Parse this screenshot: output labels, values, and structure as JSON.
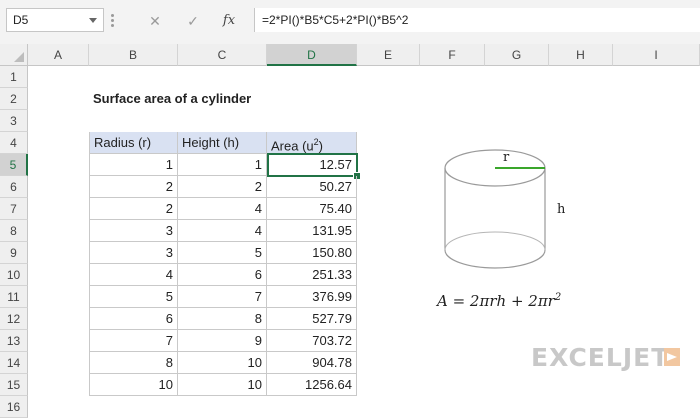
{
  "name_box": "D5",
  "formula_bar": {
    "cancel_glyph": "✕",
    "enter_glyph": "✓",
    "fx_label": "fx",
    "formula": "=2*PI()*B5*C5+2*PI()*B5^2"
  },
  "columns": [
    "A",
    "B",
    "C",
    "D",
    "E",
    "F",
    "G",
    "H",
    "I"
  ],
  "rows": [
    "1",
    "2",
    "3",
    "4",
    "5",
    "6",
    "7",
    "8",
    "9",
    "10",
    "11",
    "12",
    "13",
    "14",
    "15",
    "16"
  ],
  "sheet": {
    "title": "Surface area of a cylinder",
    "headers": {
      "radius": "Radius (r)",
      "height": "Height (h)",
      "area": "Area (u",
      "area_sup": "2",
      "area_close": ")"
    },
    "data_rows": [
      {
        "r": "1",
        "h": "1",
        "area": "12.57"
      },
      {
        "r": "2",
        "h": "2",
        "area": "50.27"
      },
      {
        "r": "2",
        "h": "4",
        "area": "75.40"
      },
      {
        "r": "3",
        "h": "4",
        "area": "131.95"
      },
      {
        "r": "3",
        "h": "5",
        "area": "150.80"
      },
      {
        "r": "4",
        "h": "6",
        "area": "251.33"
      },
      {
        "r": "5",
        "h": "7",
        "area": "376.99"
      },
      {
        "r": "6",
        "h": "8",
        "area": "527.79"
      },
      {
        "r": "7",
        "h": "9",
        "area": "703.72"
      },
      {
        "r": "8",
        "h": "10",
        "area": "904.78"
      },
      {
        "r": "10",
        "h": "10",
        "area": "1256.64"
      }
    ]
  },
  "diagram": {
    "radius_label": "r",
    "height_label": "h",
    "formula_parts": {
      "lhs": "A = 2πrh + 2πr",
      "exp": "2"
    }
  },
  "logo": "EXCELJET",
  "colors": {
    "accent": "#217346",
    "header_fill": "#d9e1f2",
    "radius_line": "#3aa62b"
  }
}
